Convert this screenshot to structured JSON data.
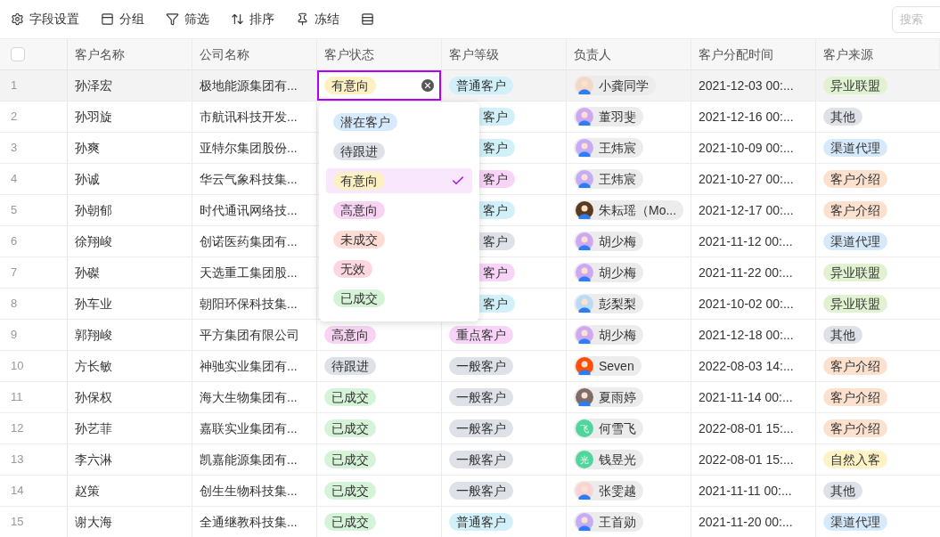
{
  "toolbar": {
    "buttons": [
      {
        "kind": "settings",
        "label": "字段设置"
      },
      {
        "kind": "group",
        "label": "分组"
      },
      {
        "kind": "filter",
        "label": "筛选"
      },
      {
        "kind": "sort",
        "label": "排序"
      },
      {
        "kind": "pin",
        "label": "冻结"
      },
      {
        "kind": "rowheight"
      }
    ],
    "search": {
      "placeholder": "搜索"
    }
  },
  "table": {
    "select_all": {
      "checked": false
    },
    "columns": [
      "客户名称",
      "公司名称",
      "客户状态",
      "客户等级",
      "负责人",
      "客户分配时间",
      "客户来源"
    ],
    "rows": [
      {
        "no": "1",
        "selected": true,
        "name": "孙泽宏",
        "company": "极地能源集团有...",
        "status": {
          "label": "有意向",
          "color": "#fdf0c2",
          "editing": true
        },
        "level": {
          "label": "普通客户",
          "color": "#d2f0f9",
          "cut": false
        },
        "owner": {
          "name": "小龚同学",
          "avatar": {
            "kind": "image",
            "color": "#f3d9c6"
          }
        },
        "assigned": "2021-12-03 00:...",
        "source": {
          "label": "异业联盟",
          "color": "#e1f2d1"
        }
      },
      {
        "no": "2",
        "selected": false,
        "name": "孙羽旋",
        "company": "市航讯科技开发...",
        "level": {
          "label": "客户",
          "color": "#d2f0f9",
          "cut": true
        },
        "owner": {
          "name": "董羽斐",
          "avatar": {
            "kind": "image",
            "color": "#cfa8f3"
          }
        },
        "assigned": "2021-12-16 00:...",
        "source": {
          "label": "其他",
          "color": "#dee1e7"
        }
      },
      {
        "no": "3",
        "selected": false,
        "name": "孙爽",
        "company": "亚特尔集团股份...",
        "level": {
          "label": "客户",
          "color": "#d2f0f9",
          "cut": true
        },
        "owner": {
          "name": "王炜宸",
          "avatar": {
            "kind": "image",
            "color": "#c6acf6"
          }
        },
        "assigned": "2021-10-09 00:...",
        "source": {
          "label": "渠道代理",
          "color": "#d7eafc"
        }
      },
      {
        "no": "4",
        "selected": false,
        "name": "孙诚",
        "company": "华云气象科技集...",
        "level": {
          "label": "客户",
          "color": "#f8d4f8",
          "cut": true
        },
        "owner": {
          "name": "王炜宸",
          "avatar": {
            "kind": "image",
            "color": "#c6acf6"
          }
        },
        "assigned": "2021-10-27 00:...",
        "source": {
          "label": "客户介绍",
          "color": "#fde1cf"
        }
      },
      {
        "no": "5",
        "selected": false,
        "name": "孙朝郁",
        "company": "时代通讯网络技...",
        "level": {
          "label": "客户",
          "color": "#d2f0f9",
          "cut": true
        },
        "owner": {
          "name": "朱耘瑶（Mo...",
          "avatar": {
            "kind": "image",
            "color": "#5a3b1e"
          }
        },
        "assigned": "2021-12-17 00:...",
        "source": {
          "label": "客户介绍",
          "color": "#fde1cf"
        }
      },
      {
        "no": "6",
        "selected": false,
        "name": "徐翔峻",
        "company": "创诺医药集团有...",
        "level": {
          "label": "客户",
          "color": "#dee1e7",
          "cut": true
        },
        "owner": {
          "name": "胡少梅",
          "avatar": {
            "kind": "image",
            "color": "#cfa8f3"
          }
        },
        "assigned": "2021-11-12 00:...",
        "source": {
          "label": "渠道代理",
          "color": "#d7eafc"
        }
      },
      {
        "no": "7",
        "selected": false,
        "name": "孙磔",
        "company": "天选重工集团股...",
        "level": {
          "label": "客户",
          "color": "#f8d4f8",
          "cut": true
        },
        "owner": {
          "name": "胡少梅",
          "avatar": {
            "kind": "image",
            "color": "#cfa8f3"
          }
        },
        "assigned": "2021-11-22 00:...",
        "source": {
          "label": "异业联盟",
          "color": "#e1f2d1"
        }
      },
      {
        "no": "8",
        "selected": false,
        "name": "孙车业",
        "company": "朝阳环保科技集...",
        "level": {
          "label": "客户",
          "color": "#d2f0f9",
          "cut": true
        },
        "owner": {
          "name": "彭梨梨",
          "avatar": {
            "kind": "image",
            "color": "#bcdaf6"
          }
        },
        "assigned": "2021-10-02 00:...",
        "source": {
          "label": "异业联盟",
          "color": "#e1f2d1"
        }
      },
      {
        "no": "9",
        "selected": false,
        "name": "郭翔峻",
        "company": "平方集团有限公司",
        "status": {
          "label": "高意向",
          "color": "#f6d4f2",
          "editing": false
        },
        "level": {
          "label": "重点客户",
          "color": "#f8d4f8",
          "cut": false
        },
        "owner": {
          "name": "胡少梅",
          "avatar": {
            "kind": "image",
            "color": "#cfa8f3"
          }
        },
        "assigned": "2021-12-18 00:...",
        "source": {
          "label": "其他",
          "color": "#dee1e7"
        }
      },
      {
        "no": "10",
        "selected": false,
        "name": "方长敏",
        "company": "神驰实业集团有...",
        "status": {
          "label": "待跟进",
          "color": "#dee1e7",
          "editing": false
        },
        "level": {
          "label": "一般客户",
          "color": "#dee1e7",
          "cut": false
        },
        "owner": {
          "name": "Seven",
          "avatar": {
            "kind": "image",
            "color": "#ff4f0a"
          }
        },
        "assigned": "2022-08-03 14:...",
        "source": {
          "label": "客户介绍",
          "color": "#fde1cf"
        }
      },
      {
        "no": "11",
        "selected": false,
        "name": "孙保权",
        "company": "海大生物集团有...",
        "status": {
          "label": "已成交",
          "color": "#d4f3d7",
          "editing": false
        },
        "level": {
          "label": "一般客户",
          "color": "#dee1e7",
          "cut": false
        },
        "owner": {
          "name": "夏雨婷",
          "avatar": {
            "kind": "image",
            "color": "#7d6c68"
          }
        },
        "assigned": "2021-11-14 00:...",
        "source": {
          "label": "客户介绍",
          "color": "#fde1cf"
        }
      },
      {
        "no": "12",
        "selected": false,
        "name": "孙艺菲",
        "company": "嘉联实业集团有...",
        "status": {
          "label": "已成交",
          "color": "#d4f3d7",
          "editing": false
        },
        "level": {
          "label": "一般客户",
          "color": "#dee1e7",
          "cut": false
        },
        "owner": {
          "name": "何雪飞",
          "avatar": {
            "kind": "text",
            "color": "#4fd69c",
            "text": "飞"
          }
        },
        "assigned": "2022-08-01 15:...",
        "source": {
          "label": "客户介绍",
          "color": "#fde1cf"
        }
      },
      {
        "no": "13",
        "selected": false,
        "name": "李六淋",
        "company": "凯嘉能源集团有...",
        "status": {
          "label": "已成交",
          "color": "#d4f3d7",
          "editing": false
        },
        "level": {
          "label": "一般客户",
          "color": "#dee1e7",
          "cut": false
        },
        "owner": {
          "name": "钱昱光",
          "avatar": {
            "kind": "text",
            "color": "#4fd69c",
            "text": "光"
          }
        },
        "assigned": "2022-08-01 15:...",
        "source": {
          "label": "自然入客",
          "color": "#fdf3c5"
        }
      },
      {
        "no": "14",
        "selected": false,
        "name": "赵策",
        "company": "创生生物科技集...",
        "status": {
          "label": "已成交",
          "color": "#d4f3d7",
          "editing": false
        },
        "level": {
          "label": "一般客户",
          "color": "#dee1e7",
          "cut": false
        },
        "owner": {
          "name": "张雯越",
          "avatar": {
            "kind": "image",
            "color": "#fbd3d3"
          }
        },
        "assigned": "2021-11-11 00:...",
        "source": {
          "label": "其他",
          "color": "#dee1e7"
        }
      },
      {
        "no": "15",
        "selected": false,
        "name": "谢大海",
        "company": "全通继教科技集...",
        "status": {
          "label": "已成交",
          "color": "#d4f3d7",
          "editing": false
        },
        "level": {
          "label": "普通客户",
          "color": "#d2f0f9",
          "cut": false
        },
        "owner": {
          "name": "王首勋",
          "avatar": {
            "kind": "image",
            "color": "#c6acf6"
          }
        },
        "assigned": "2021-11-20 00:...",
        "source": {
          "label": "渠道代理",
          "color": "#d7eafc"
        }
      }
    ]
  },
  "status_dropdown": {
    "options": [
      {
        "label": "潜在客户",
        "color": "#d7eafc",
        "selected": false
      },
      {
        "label": "待跟进",
        "color": "#dee1e7",
        "selected": false
      },
      {
        "label": "有意向",
        "color": "#fdf0c2",
        "selected": true
      },
      {
        "label": "高意向",
        "color": "#f6d4f2",
        "selected": false
      },
      {
        "label": "未成交",
        "color": "#fddcd6",
        "selected": false
      },
      {
        "label": "无效",
        "color": "#fdd7e0",
        "selected": false
      },
      {
        "label": "已成交",
        "color": "#d4f3d7",
        "selected": false
      }
    ]
  }
}
